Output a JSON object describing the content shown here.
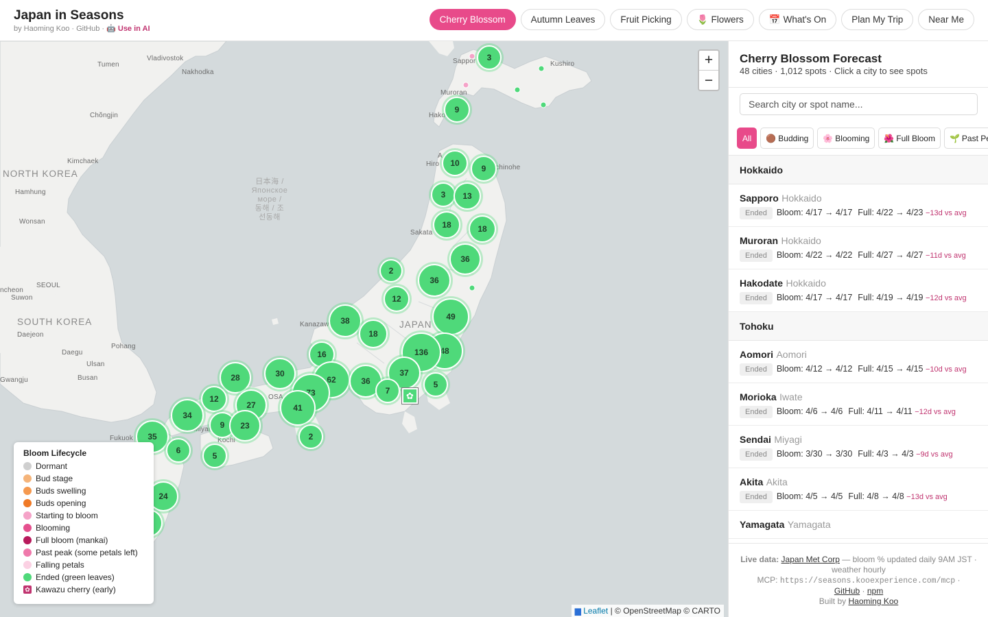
{
  "header": {
    "title": "Japan in Seasons",
    "byline": "by Haoming Koo · GitHub · 🤖",
    "use_ai": "Use in AI",
    "nav": [
      {
        "label": "Cherry Blossom",
        "icon": "",
        "active": true
      },
      {
        "label": "Autumn Leaves",
        "icon": "",
        "active": false
      },
      {
        "label": "Fruit Picking",
        "icon": "",
        "active": false
      },
      {
        "label": "Flowers",
        "icon": "🌷",
        "active": false
      },
      {
        "label": "What's On",
        "icon": "📅",
        "active": false
      },
      {
        "label": "Plan My Trip",
        "icon": "",
        "active": false
      },
      {
        "label": "Near Me",
        "icon": "",
        "active": false
      }
    ]
  },
  "map": {
    "places": [
      {
        "name": "Vladivostok",
        "type": "city"
      },
      {
        "name": "Tumen",
        "type": "city"
      },
      {
        "name": "Nakhodka",
        "type": "city"
      },
      {
        "name": "Chŏngjin",
        "type": "city"
      },
      {
        "name": "Kimchaek",
        "type": "city"
      },
      {
        "name": "NORTH KOREA",
        "type": "country"
      },
      {
        "name": "Hamhung",
        "type": "city"
      },
      {
        "name": "Wonsan",
        "type": "city"
      },
      {
        "name": "SEOUL",
        "type": "city"
      },
      {
        "name": "ncheon",
        "type": "city"
      },
      {
        "name": "Suwon",
        "type": "city"
      },
      {
        "name": "SOUTH KOREA",
        "type": "country"
      },
      {
        "name": "Daejeon",
        "type": "city"
      },
      {
        "name": "Pohang",
        "type": "city"
      },
      {
        "name": "Daegu",
        "type": "city"
      },
      {
        "name": "Ulsan",
        "type": "city"
      },
      {
        "name": "Gwangju",
        "type": "city"
      },
      {
        "name": "Busan",
        "type": "city"
      },
      {
        "name": "JAPAN",
        "type": "country"
      },
      {
        "name": "Kanazaw",
        "type": "city"
      },
      {
        "name": "Sakata",
        "type": "city"
      },
      {
        "name": "Kushiro",
        "type": "city"
      },
      {
        "name": "Sappor",
        "type": "city"
      },
      {
        "name": "Muroran",
        "type": "city"
      },
      {
        "name": "Hako",
        "type": "city"
      },
      {
        "name": "Hiro",
        "type": "city"
      },
      {
        "name": "A",
        "type": "city"
      },
      {
        "name": "chinohe",
        "type": "city"
      },
      {
        "name": "OSA",
        "type": "city"
      },
      {
        "name": "Fukuok",
        "type": "city"
      },
      {
        "name": "Kochi",
        "type": "city"
      },
      {
        "name": "Miyam",
        "type": "city"
      }
    ],
    "sea_label": [
      "日本海 /",
      "Японское",
      "море /",
      "동해 / 조",
      "선동해"
    ],
    "clusters": [
      {
        "count": "3"
      },
      {
        "count": "9"
      },
      {
        "count": "10"
      },
      {
        "count": "9"
      },
      {
        "count": "3"
      },
      {
        "count": "13"
      },
      {
        "count": "18"
      },
      {
        "count": "18"
      },
      {
        "count": "36"
      },
      {
        "count": "2"
      },
      {
        "count": "36"
      },
      {
        "count": "12"
      },
      {
        "count": "49"
      },
      {
        "count": "38"
      },
      {
        "count": "18"
      },
      {
        "count": "48"
      },
      {
        "count": "136"
      },
      {
        "count": "16"
      },
      {
        "count": "62"
      },
      {
        "count": "36"
      },
      {
        "count": "37"
      },
      {
        "count": "5"
      },
      {
        "count": "7"
      },
      {
        "count": "30"
      },
      {
        "count": "73"
      },
      {
        "count": "28"
      },
      {
        "count": "12"
      },
      {
        "count": "27"
      },
      {
        "count": "41"
      },
      {
        "count": "34"
      },
      {
        "count": "9"
      },
      {
        "count": "23"
      },
      {
        "count": "35"
      },
      {
        "count": "2"
      },
      {
        "count": "6"
      },
      {
        "count": "5"
      },
      {
        "count": "24"
      },
      {
        "count": ""
      }
    ],
    "zoom_in": "+",
    "zoom_out": "−",
    "star_marker": "✿",
    "legend": {
      "title": "Bloom Lifecycle",
      "items": [
        {
          "label": "Dormant",
          "color": "#cfcfcf"
        },
        {
          "label": "Bud stage",
          "color": "#f5b47a"
        },
        {
          "label": "Buds swelling",
          "color": "#f5994f"
        },
        {
          "label": "Buds opening",
          "color": "#f07a26"
        },
        {
          "label": "Starting to bloom",
          "color": "#f5a3c8"
        },
        {
          "label": "Blooming",
          "color": "#e5508e"
        },
        {
          "label": "Full bloom (mankai)",
          "color": "#b81a5c"
        },
        {
          "label": "Past peak (some petals left)",
          "color": "#ef79ab"
        },
        {
          "label": "Falling petals",
          "color": "#fbd1e3"
        },
        {
          "label": "Ended (green leaves)",
          "color": "#4fd97a"
        },
        {
          "label": "Kawazu cherry (early)",
          "color": "#c0336f"
        }
      ]
    },
    "attribution": {
      "flag": "▆",
      "leaflet": "Leaflet",
      "rest": " | © OpenStreetMap © CARTO"
    }
  },
  "panel": {
    "title": "Cherry Blossom Forecast",
    "subtitle": "48 cities · 1,012 spots · Click a city to see spots",
    "search_placeholder": "Search city or spot name...",
    "filters": [
      {
        "label": "All",
        "icon": "",
        "active": true
      },
      {
        "label": "Budding",
        "icon": "🟤",
        "active": false
      },
      {
        "label": "Blooming",
        "icon": "🌸",
        "active": false
      },
      {
        "label": "Full Bloom",
        "icon": "🌺",
        "active": false
      },
      {
        "label": "Past Peak",
        "icon": "🌱",
        "active": false
      }
    ],
    "regions": [
      {
        "name": "Hokkaido",
        "cities": [
          {
            "name": "Sapporo",
            "pref": "Hokkaido",
            "status": "Ended",
            "bloom": "Bloom: 4/17 → 4/17",
            "full": "Full: 4/22 → 4/23",
            "vs": "−13d vs avg"
          },
          {
            "name": "Muroran",
            "pref": "Hokkaido",
            "status": "Ended",
            "bloom": "Bloom: 4/22 → 4/22",
            "full": "Full: 4/27 → 4/27",
            "vs": "−11d vs avg"
          },
          {
            "name": "Hakodate",
            "pref": "Hokkaido",
            "status": "Ended",
            "bloom": "Bloom: 4/17 → 4/17",
            "full": "Full: 4/19 → 4/19",
            "vs": "−12d vs avg"
          }
        ]
      },
      {
        "name": "Tohoku",
        "cities": [
          {
            "name": "Aomori",
            "pref": "Aomori",
            "status": "Ended",
            "bloom": "Bloom: 4/12 → 4/12",
            "full": "Full: 4/15 → 4/15",
            "vs": "−10d vs avg"
          },
          {
            "name": "Morioka",
            "pref": "Iwate",
            "status": "Ended",
            "bloom": "Bloom: 4/6 → 4/6",
            "full": "Full: 4/11 → 4/11",
            "vs": "−12d vs avg"
          },
          {
            "name": "Sendai",
            "pref": "Miyagi",
            "status": "Ended",
            "bloom": "Bloom: 3/30 → 3/30",
            "full": "Full: 4/3 → 4/3",
            "vs": "−9d vs avg"
          },
          {
            "name": "Akita",
            "pref": "Akita",
            "status": "Ended",
            "bloom": "Bloom: 4/5 → 4/5",
            "full": "Full: 4/8 → 4/8",
            "vs": "−13d vs avg"
          },
          {
            "name": "Yamagata",
            "pref": "Yamagata",
            "status": "",
            "bloom": "",
            "full": "",
            "vs": ""
          }
        ]
      }
    ],
    "footer": {
      "live_label": "Live data:",
      "source": "Japan Met Corp",
      "source_rest": " — bloom % updated daily 9AM JST · weather hourly",
      "mcp_label": "MCP: ",
      "mcp_url": "https://seasons.kooexperience.com/mcp",
      "mcp_sep": " ·",
      "github": "GitHub",
      "sep": " · ",
      "npm": "npm",
      "built_by": "Built by ",
      "author": "Haoming Koo"
    }
  }
}
